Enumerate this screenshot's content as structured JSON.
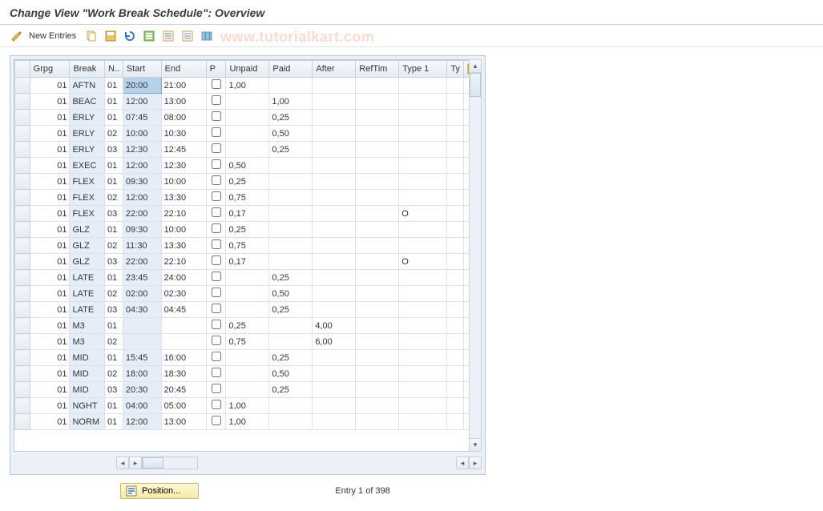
{
  "header": {
    "title": "Change View \"Work Break Schedule\": Overview"
  },
  "toolbar": {
    "new_entries": "New Entries"
  },
  "watermark": "www.tutorialkart.com",
  "columns": {
    "grpg": "Grpg",
    "break": "Break",
    "n": "N..",
    "start": "Start",
    "end": "End",
    "p": "P",
    "unpaid": "Unpaid",
    "paid": "Paid",
    "after": "After",
    "reftim": "RefTim",
    "type1": "Type 1",
    "type2": "Ty"
  },
  "rows": [
    {
      "grpg": "01",
      "break": "AFTN",
      "n": "01",
      "start": "20:00",
      "end": "21:00",
      "unpaid": "1,00",
      "paid": "",
      "after": "",
      "type1": ""
    },
    {
      "grpg": "01",
      "break": "BEAC",
      "n": "01",
      "start": "12:00",
      "end": "13:00",
      "unpaid": "",
      "paid": "1,00",
      "after": "",
      "type1": ""
    },
    {
      "grpg": "01",
      "break": "ERLY",
      "n": "01",
      "start": "07:45",
      "end": "08:00",
      "unpaid": "",
      "paid": "0,25",
      "after": "",
      "type1": ""
    },
    {
      "grpg": "01",
      "break": "ERLY",
      "n": "02",
      "start": "10:00",
      "end": "10:30",
      "unpaid": "",
      "paid": "0,50",
      "after": "",
      "type1": ""
    },
    {
      "grpg": "01",
      "break": "ERLY",
      "n": "03",
      "start": "12:30",
      "end": "12:45",
      "unpaid": "",
      "paid": "0,25",
      "after": "",
      "type1": ""
    },
    {
      "grpg": "01",
      "break": "EXEC",
      "n": "01",
      "start": "12:00",
      "end": "12:30",
      "unpaid": "0,50",
      "paid": "",
      "after": "",
      "type1": ""
    },
    {
      "grpg": "01",
      "break": "FLEX",
      "n": "01",
      "start": "09:30",
      "end": "10:00",
      "unpaid": "0,25",
      "paid": "",
      "after": "",
      "type1": ""
    },
    {
      "grpg": "01",
      "break": "FLEX",
      "n": "02",
      "start": "12:00",
      "end": "13:30",
      "unpaid": "0,75",
      "paid": "",
      "after": "",
      "type1": ""
    },
    {
      "grpg": "01",
      "break": "FLEX",
      "n": "03",
      "start": "22:00",
      "end": "22:10",
      "unpaid": "0,17",
      "paid": "",
      "after": "",
      "type1": "O"
    },
    {
      "grpg": "01",
      "break": "GLZ",
      "n": "01",
      "start": "09:30",
      "end": "10:00",
      "unpaid": "0,25",
      "paid": "",
      "after": "",
      "type1": ""
    },
    {
      "grpg": "01",
      "break": "GLZ",
      "n": "02",
      "start": "11:30",
      "end": "13:30",
      "unpaid": "0,75",
      "paid": "",
      "after": "",
      "type1": ""
    },
    {
      "grpg": "01",
      "break": "GLZ",
      "n": "03",
      "start": "22:00",
      "end": "22:10",
      "unpaid": "0,17",
      "paid": "",
      "after": "",
      "type1": "O"
    },
    {
      "grpg": "01",
      "break": "LATE",
      "n": "01",
      "start": "23:45",
      "end": "24:00",
      "unpaid": "",
      "paid": "0,25",
      "after": "",
      "type1": ""
    },
    {
      "grpg": "01",
      "break": "LATE",
      "n": "02",
      "start": "02:00",
      "end": "02:30",
      "unpaid": "",
      "paid": "0,50",
      "after": "",
      "type1": ""
    },
    {
      "grpg": "01",
      "break": "LATE",
      "n": "03",
      "start": "04:30",
      "end": "04:45",
      "unpaid": "",
      "paid": "0,25",
      "after": "",
      "type1": ""
    },
    {
      "grpg": "01",
      "break": "M3",
      "n": "01",
      "start": "",
      "end": "",
      "unpaid": "0,25",
      "paid": "",
      "after": "4,00",
      "type1": ""
    },
    {
      "grpg": "01",
      "break": "M3",
      "n": "02",
      "start": "",
      "end": "",
      "unpaid": "0,75",
      "paid": "",
      "after": "6,00",
      "type1": ""
    },
    {
      "grpg": "01",
      "break": "MID",
      "n": "01",
      "start": "15:45",
      "end": "16:00",
      "unpaid": "",
      "paid": "0,25",
      "after": "",
      "type1": ""
    },
    {
      "grpg": "01",
      "break": "MID",
      "n": "02",
      "start": "18:00",
      "end": "18:30",
      "unpaid": "",
      "paid": "0,50",
      "after": "",
      "type1": ""
    },
    {
      "grpg": "01",
      "break": "MID",
      "n": "03",
      "start": "20:30",
      "end": "20:45",
      "unpaid": "",
      "paid": "0,25",
      "after": "",
      "type1": ""
    },
    {
      "grpg": "01",
      "break": "NGHT",
      "n": "01",
      "start": "04:00",
      "end": "05:00",
      "unpaid": "1,00",
      "paid": "",
      "after": "",
      "type1": ""
    },
    {
      "grpg": "01",
      "break": "NORM",
      "n": "01",
      "start": "12:00",
      "end": "13:00",
      "unpaid": "1,00",
      "paid": "",
      "after": "",
      "type1": ""
    }
  ],
  "footer": {
    "position_label": "Position...",
    "entry_status": "Entry 1 of 398"
  }
}
